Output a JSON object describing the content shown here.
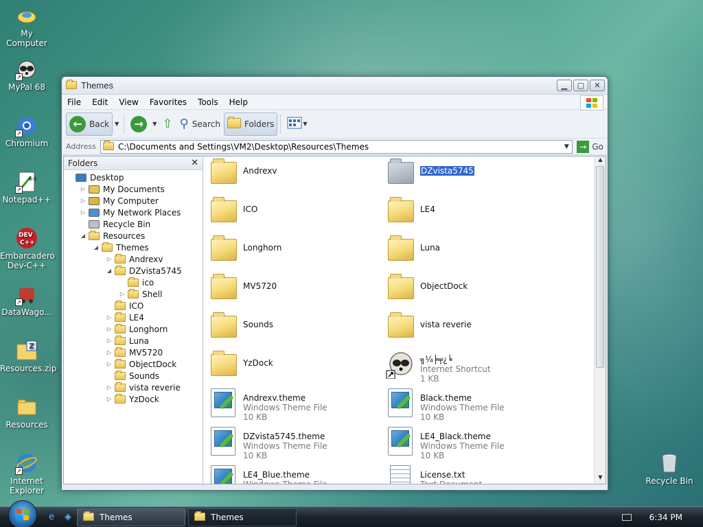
{
  "desktop": {
    "icons": [
      {
        "label": "My Computer",
        "icon": "my-computer-icon"
      },
      {
        "label": "MyPal 68",
        "icon": "mypal-icon"
      },
      {
        "label": "Chromium",
        "icon": "chromium-icon"
      },
      {
        "label": "Notepad++",
        "icon": "notepad-plus-plus-icon"
      },
      {
        "label": "Embarcadero Dev-C++",
        "label_line1": "Embarcadero",
        "label_line2": "Dev-C++",
        "icon": "devcpp-icon"
      },
      {
        "label": "DataWago...",
        "icon": "datawagon-icon"
      },
      {
        "label": "Resources.zip",
        "icon": "zip-folder-icon"
      },
      {
        "label": "Resources",
        "icon": "folder-icon"
      },
      {
        "label": "Internet Explorer",
        "label_line1": "Internet",
        "label_line2": "Explorer",
        "icon": "internet-explorer-icon"
      }
    ],
    "recycle_bin": "Recycle Bin"
  },
  "window": {
    "title": "Themes",
    "menu": [
      "File",
      "Edit",
      "View",
      "Favorites",
      "Tools",
      "Help"
    ],
    "toolbar": {
      "back": "Back",
      "search": "Search",
      "folders": "Folders"
    },
    "address": {
      "label": "Address",
      "value": "C:\\Documents and Settings\\VM2\\Desktop\\Resources\\Themes",
      "go": "Go"
    },
    "tree": {
      "header": "Folders",
      "nodes": [
        {
          "label": "Desktop",
          "depth": 0,
          "expander": "",
          "icon": "desktop-icon"
        },
        {
          "label": "My Documents",
          "depth": 1,
          "expander": "▷",
          "icon": "my-documents-icon"
        },
        {
          "label": "My Computer",
          "depth": 1,
          "expander": "▷",
          "icon": "my-computer-icon"
        },
        {
          "label": "My Network Places",
          "depth": 1,
          "expander": "▷",
          "icon": "network-places-icon"
        },
        {
          "label": "Recycle Bin",
          "depth": 1,
          "expander": "",
          "icon": "recycle-bin-icon"
        },
        {
          "label": "Resources",
          "depth": 1,
          "expander": "◢",
          "icon": "folder-icon"
        },
        {
          "label": "Themes",
          "depth": 2,
          "expander": "◢",
          "icon": "folder-icon"
        },
        {
          "label": "Andrexv",
          "depth": 3,
          "expander": "▷",
          "icon": "folder-icon"
        },
        {
          "label": "DZvista5745",
          "depth": 3,
          "expander": "◢",
          "icon": "folder-icon"
        },
        {
          "label": "ico",
          "depth": 4,
          "expander": "",
          "icon": "folder-icon"
        },
        {
          "label": "Shell",
          "depth": 4,
          "expander": "▷",
          "icon": "folder-icon"
        },
        {
          "label": "ICO",
          "depth": 3,
          "expander": "",
          "icon": "folder-icon"
        },
        {
          "label": "LE4",
          "depth": 3,
          "expander": "▷",
          "icon": "folder-icon"
        },
        {
          "label": "Longhorn",
          "depth": 3,
          "expander": "▷",
          "icon": "folder-icon"
        },
        {
          "label": "Luna",
          "depth": 3,
          "expander": "▷",
          "icon": "folder-icon"
        },
        {
          "label": "MV5720",
          "depth": 3,
          "expander": "▷",
          "icon": "folder-icon"
        },
        {
          "label": "ObjectDock",
          "depth": 3,
          "expander": "▷",
          "icon": "folder-icon"
        },
        {
          "label": "Sounds",
          "depth": 3,
          "expander": "",
          "icon": "folder-icon"
        },
        {
          "label": "vista reverie",
          "depth": 3,
          "expander": "▷",
          "icon": "folder-icon"
        },
        {
          "label": "YzDock",
          "depth": 3,
          "expander": "▷",
          "icon": "folder-icon"
        }
      ]
    },
    "files": [
      {
        "name": "Andrexv",
        "type": "",
        "size": "",
        "kind": "folder"
      },
      {
        "name": "DZvista5745",
        "type": "",
        "size": "",
        "kind": "folder-grey",
        "selected": true
      },
      {
        "name": "ICO",
        "type": "",
        "size": "",
        "kind": "folder"
      },
      {
        "name": "LE4",
        "type": "",
        "size": "",
        "kind": "folder"
      },
      {
        "name": "Longhorn",
        "type": "",
        "size": "",
        "kind": "folder"
      },
      {
        "name": "Luna",
        "type": "",
        "size": "",
        "kind": "folder"
      },
      {
        "name": "MV5720",
        "type": "",
        "size": "",
        "kind": "folder"
      },
      {
        "name": "ObjectDock",
        "type": "",
        "size": "",
        "kind": "folder"
      },
      {
        "name": "Sounds",
        "type": "",
        "size": "",
        "kind": "folder"
      },
      {
        "name": "vista reverie",
        "type": "",
        "size": "",
        "kind": "folder"
      },
      {
        "name": "YzDock",
        "type": "",
        "size": "",
        "kind": "folder"
      },
      {
        "name": "╗¼╞╤¿╘",
        "type": "Internet Shortcut",
        "size": "1 KB",
        "kind": "shortcut"
      },
      {
        "name": "Andrexv.theme",
        "type": "Windows Theme File",
        "size": "10 KB",
        "kind": "theme"
      },
      {
        "name": "Black.theme",
        "type": "Windows Theme File",
        "size": "10 KB",
        "kind": "theme"
      },
      {
        "name": "DZvista5745.theme",
        "type": "Windows Theme File",
        "size": "10 KB",
        "kind": "theme"
      },
      {
        "name": "LE4_Black.theme",
        "type": "Windows Theme File",
        "size": "10 KB",
        "kind": "theme"
      },
      {
        "name": "LE4_Blue.theme",
        "type": "Windows Theme File",
        "size": "",
        "kind": "theme"
      },
      {
        "name": "License.txt",
        "type": "Text Document",
        "size": "",
        "kind": "text"
      }
    ]
  },
  "taskbar": {
    "buttons": [
      "Themes",
      "Themes"
    ],
    "clock": "6:34 PM"
  }
}
